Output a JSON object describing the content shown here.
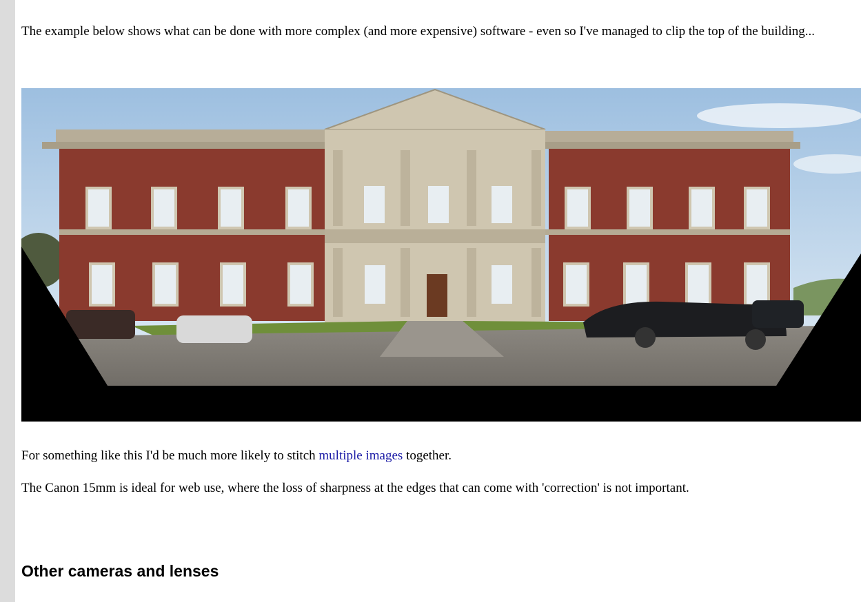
{
  "article": {
    "intro_text": "The example below shows what can be done with more complex (and more expensive) software - even so I've managed to clip the top of the building...",
    "stitch_text_before": "For something like this I'd be much more likely to stitch ",
    "stitch_link_label": "multiple images",
    "stitch_text_after": " together.",
    "canon_text": "The Canon 15mm is ideal for web use, where the loss of sharpness at the edges that can come with 'correction' is not important.",
    "section_heading": "Other cameras and lenses"
  },
  "colors": {
    "link": "#1a1aa6",
    "left_bar": "#dcdcdc",
    "brick": "#8a3a2e",
    "stone": "#cfc6b0"
  }
}
